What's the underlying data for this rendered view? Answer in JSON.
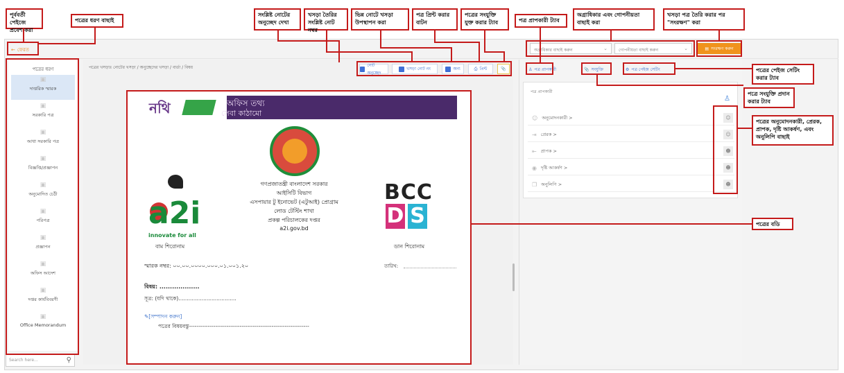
{
  "callouts": {
    "prev_page": "পূর্ববর্তী পেইজে প্রবেশ করা",
    "select_type": "পত্রের ধরণ বাছাই",
    "view_note_section": "সংশ্লিষ্ট নোটের অনুচ্ছেদ দেখা",
    "created_note_no": "খসড়া তৈরির সংশ্লিষ্ট নোট নম্বর",
    "other_note": "ভিন্ন নোটে খসড়া উপস্থাপন করা",
    "print_btn": "পত্র প্রিন্ট করার বাটন",
    "attach_tab": "পত্রের সংযুক্তি যুক্ত করার ট্যাব",
    "receiver_tab": "পত্র প্রাপকারী ট্যাব",
    "priority_secrecy": "অগ্রাধিকার এবং গোপনীয়তা বাছাই করা",
    "save_after": "খসড়া পত্র তৈরি করার পর \"সংরক্ষণ\" করা",
    "page_setting_tab": "পত্রের পেইজ সেটিং করার ট্যাব",
    "attachment_tab": "পত্রে সংযুক্তি প্রদান করার ট্যাব",
    "recipients": "পত্রের অনুমোদনকারী, প্রেরক, প্রাপক, দৃষ্টি আকর্ষণ, এবং অনুলিপি বাছাই",
    "body": "পত্রের বডি"
  },
  "back_label": "ফেরত",
  "left_panel": {
    "title": "পত্রের ধরণ",
    "items": [
      "দাপ্তরিক স্মারক",
      "সরকারি পত্র",
      "আধা সরকারি পত্র",
      "বিজ্ঞপ্তি/প্রজ্ঞাপন",
      "অনুমোদিত চেঠী",
      "পরিপত্র",
      "প্রজ্ঞাপন",
      "অফিস আদেশ",
      "দপ্তর কার্যবিবরণী",
      "Office Memorandum"
    ],
    "search_placeholder": "Search here..."
  },
  "toolbar": {
    "breadcrumb": "পত্রের খসড়াঃ নোটের খসড়া / অনুচ্ছেদের খসড়া / বার্তা / বিষয়",
    "note_btn": "নোট অনুচ্ছেদ",
    "note_no_btn": "খসড়া নোট নং",
    "other_btn": "অন্য",
    "print_btn": "প্রিন্ট"
  },
  "letter": {
    "brand_word": "নথি",
    "brand_line1": "অফিস তথ্য",
    "brand_line2": "সেবা কাঠামো",
    "gov_lines": [
      "গণপ্রজাতন্ত্রী বাংলাদেশ সরকার",
      "আইসিটি বিভাগ",
      "এসপায়ার টু ইনোভেট (এটুআই) প্রোগ্রাম",
      "লোড টেস্টিং শাখা",
      "প্রকল্প পরিচালকের দপ্তর",
      "a2i.gov.bd"
    ],
    "a2i": "a2i",
    "a2i_tag": "innovate for all",
    "left_heading": "বাম শিরোনাম",
    "bcc": "BCC",
    "ds_d": "D",
    "ds_s": "S",
    "right_heading": "ডান শিরোনাম",
    "memo": "স্মারক নম্বর: ০০.০০.০০০০.০০০.০১.০০১.২০",
    "date_label": "তারিখ:",
    "subject": "বিষয়: ...................",
    "ref": "সূত্র: (যদি থাকে)...................................",
    "edit_link": "[সম্পাদন করুন]",
    "body": "পত্রের বিষয়বস্তু----------------------------------------------------------------"
  },
  "right_panel": {
    "priority_placeholder": "অগ্রাধিকার বাছাই করুন",
    "secrecy_placeholder": "গোপনীয়তা বাছাই করুন",
    "save_label": "সংরক্ষণ করুন",
    "tabs": [
      "পত্র প্রাপকারী",
      "সংযুক্তি",
      "পত্র পেইজ সেটিং"
    ],
    "card_title": "পত্র প্রাপকারী",
    "rows": [
      "অনুমোদনকারী >",
      "প্রেরক >",
      "প্রাপক >",
      "দৃষ্টি আকর্ষণ >",
      "অনুলিপি >"
    ]
  }
}
